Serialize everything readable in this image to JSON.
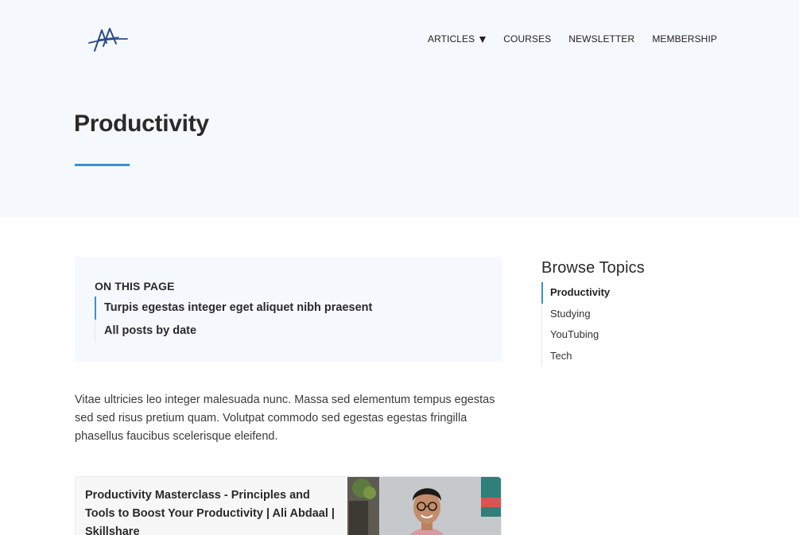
{
  "header": {
    "logo": "signature-logo",
    "nav": [
      {
        "label": "ARTICLES",
        "has_dropdown": true
      },
      {
        "label": "COURSES"
      },
      {
        "label": "NEWSLETTER"
      },
      {
        "label": "MEMBERSHIP"
      }
    ]
  },
  "page": {
    "title": "Productivity"
  },
  "toc": {
    "heading": "ON THIS PAGE",
    "items": [
      "Turpis egestas integer eget aliquet nibh praesent",
      "All posts by date"
    ]
  },
  "intro": "Vitae ultricies leo integer malesuada nunc. Massa sed elementum tempus egestas sed sed risus pretium quam. Volutpat commodo sed egestas egestas fringilla phasellus faucibus scelerisque eleifend.",
  "card": {
    "title": "Productivity Masterclass - Principles and Tools to Boost Your Productivity | Ali Abdaal | Skillshare"
  },
  "sidebar": {
    "heading": "Browse Topics",
    "topics": [
      "Productivity",
      "Studying",
      "YouTubing",
      "Tech"
    ],
    "active_topic": "Productivity"
  },
  "colors": {
    "accent": "#3b8fcf",
    "hero_bg": "#f5f9fd",
    "logo": "#2d4b84"
  }
}
